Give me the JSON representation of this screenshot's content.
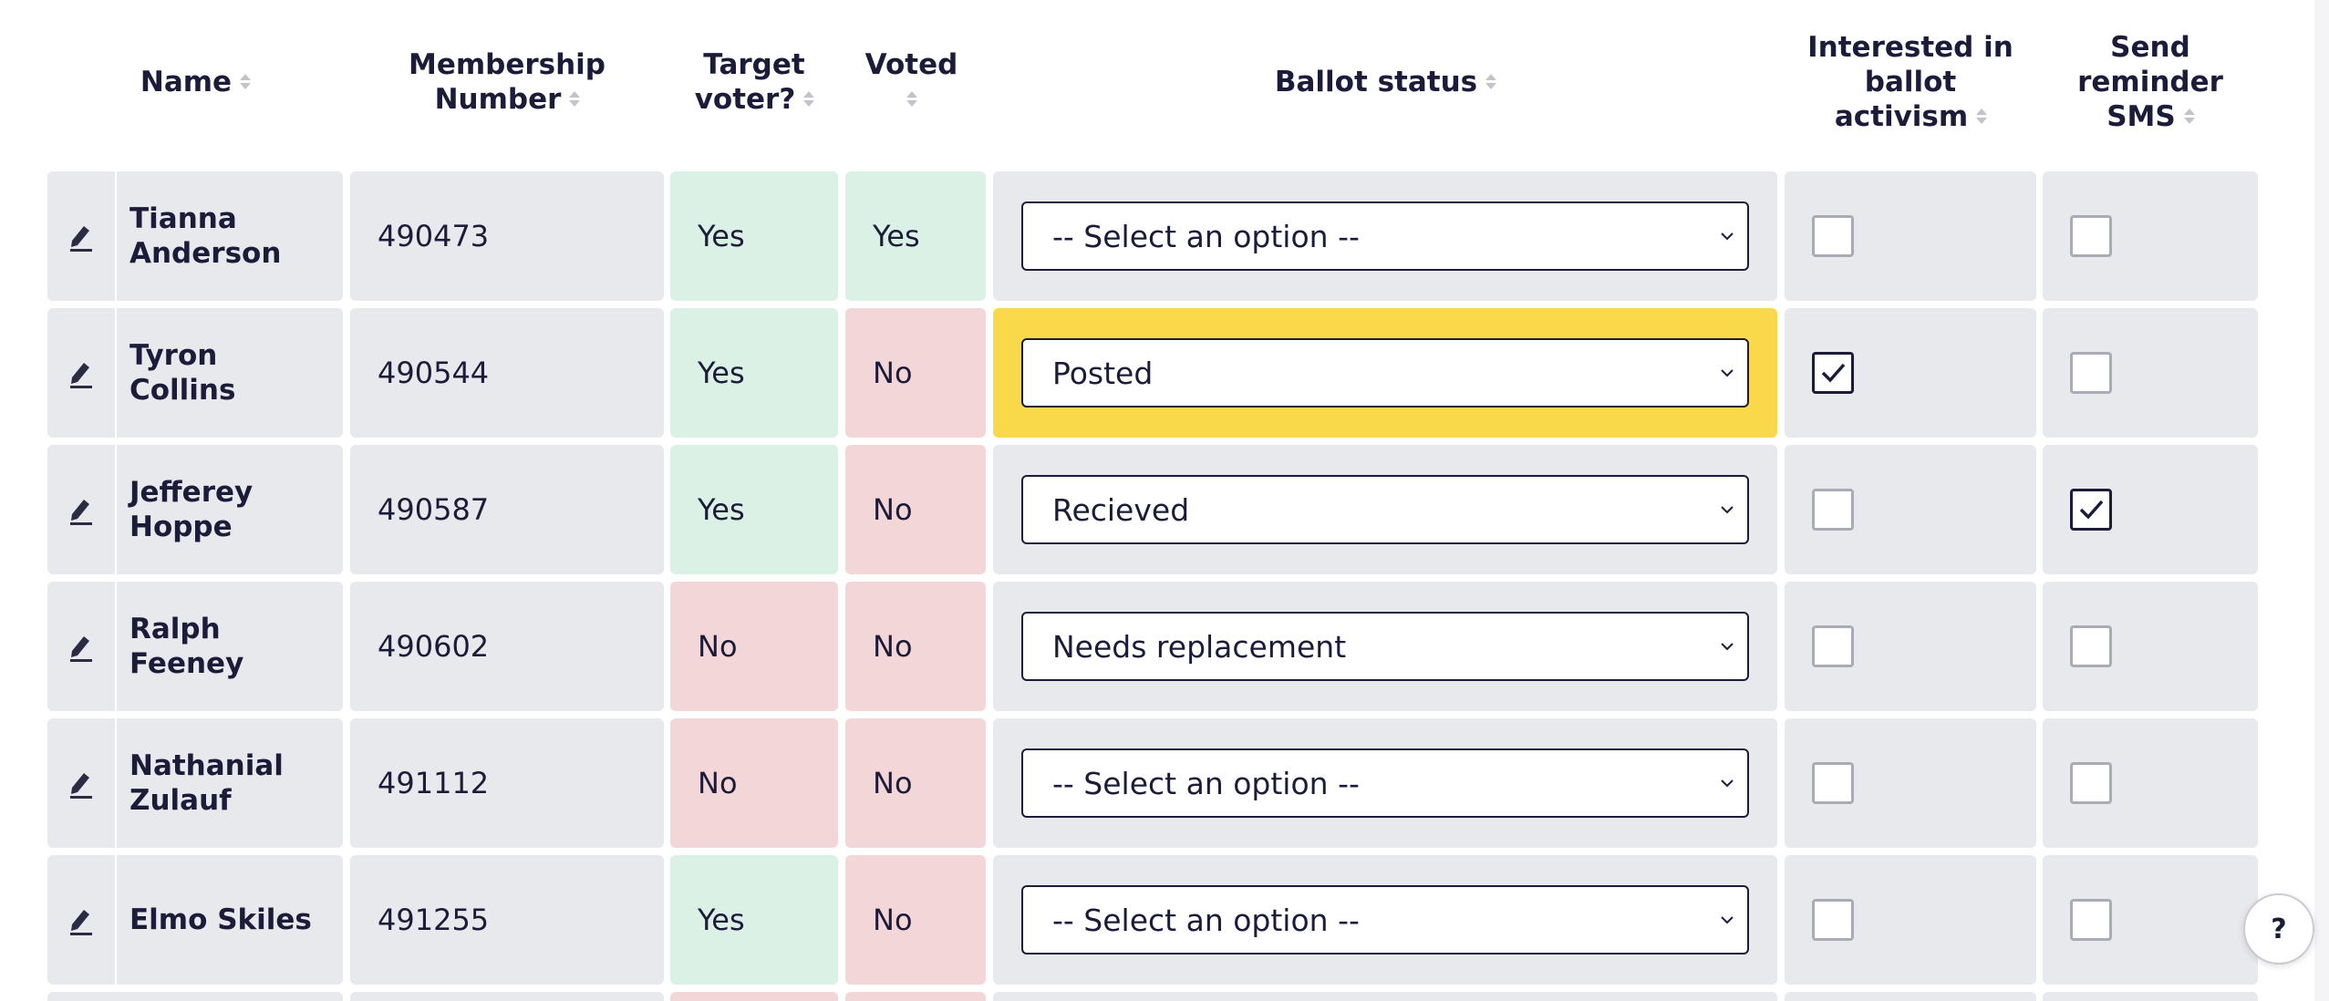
{
  "header": {
    "name": "Name",
    "membership_line1": "Membership",
    "membership_line2": "Number",
    "target_line1": "Target",
    "target_line2": "voter?",
    "voted": "Voted",
    "ballot_status": "Ballot status",
    "interested_line1": "Interested in",
    "interested_line2": "ballot",
    "interested_line3": "activism",
    "sms_line1": "Send",
    "sms_line2": "reminder",
    "sms_line3": "SMS"
  },
  "rows": [
    {
      "name_line1": "Tianna",
      "name_line2": "Anderson",
      "number": "490473",
      "target": "Yes",
      "voted": "Yes",
      "ballot_status": "-- Select an option --",
      "interested": false,
      "sms": false
    },
    {
      "name_line1": "Tyron Collins",
      "name_line2": "",
      "number": "490544",
      "target": "Yes",
      "voted": "No",
      "ballot_status": "Posted",
      "interested": true,
      "sms": false
    },
    {
      "name_line1": "Jefferey",
      "name_line2": "Hoppe",
      "number": "490587",
      "target": "Yes",
      "voted": "No",
      "ballot_status": "Recieved",
      "interested": false,
      "sms": true
    },
    {
      "name_line1": "Ralph Feeney",
      "name_line2": "",
      "number": "490602",
      "target": "No",
      "voted": "No",
      "ballot_status": "Needs replacement",
      "interested": false,
      "sms": false
    },
    {
      "name_line1": "Nathanial",
      "name_line2": "Zulauf",
      "number": "491112",
      "target": "No",
      "voted": "No",
      "ballot_status": "-- Select an option --",
      "interested": false,
      "sms": false
    },
    {
      "name_line1": "Elmo Skiles",
      "name_line2": "",
      "number": "491255",
      "target": "Yes",
      "voted": "No",
      "ballot_status": "-- Select an option --",
      "interested": false,
      "sms": false
    }
  ],
  "help": {
    "label": "?"
  },
  "colors": {
    "yes_bg": "#dcf1e6",
    "no_bg": "#f3d6d8",
    "cell_bg": "#e8e9ed",
    "highlight_bg": "#f9d94a",
    "text": "#1c1c3a"
  },
  "icons": {
    "edit": "pencil-icon",
    "sort": "sort-icon",
    "dropdown": "chevron-down-icon",
    "check": "checkmark-icon"
  }
}
